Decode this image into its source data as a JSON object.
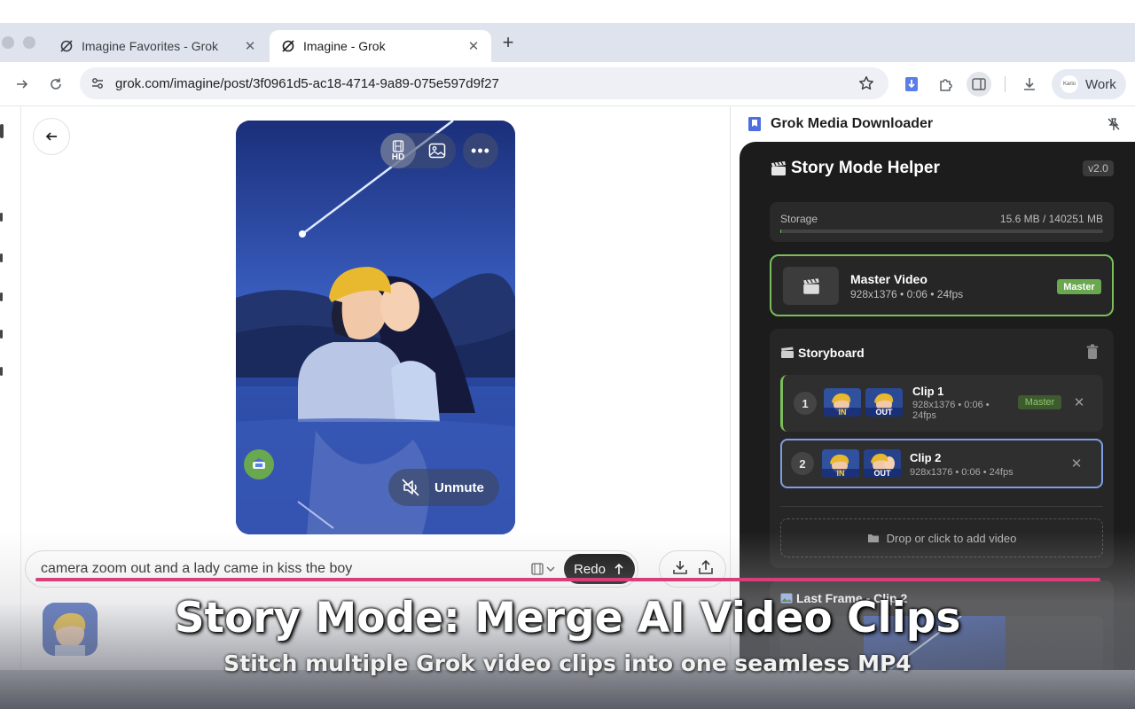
{
  "browser": {
    "tabs": [
      {
        "title": "Imagine Favorites - Grok",
        "active": false
      },
      {
        "title": "Imagine - Grok",
        "active": true
      }
    ],
    "url": "grok.com/imagine/post/3f0961d5-ac18-4714-9a89-075e597d9f27",
    "profile_label": "Work",
    "profile_avatar_text": "Kario"
  },
  "video": {
    "hd_label": "HD",
    "unmute_label": "Unmute"
  },
  "prompt": {
    "value": "camera zoom out and a lady came in kiss the boy",
    "redo_label": "Redo"
  },
  "extension": {
    "title": "Grok Media Downloader",
    "helper_title": "Story Mode Helper",
    "version": "v2.0",
    "storage": {
      "label": "Storage",
      "value": "15.6 MB / 140251 MB",
      "used_fraction": 0.0001
    },
    "master": {
      "name": "Master Video",
      "meta": "928x1376 • 0:06 • 24fps",
      "badge": "Master"
    },
    "storyboard": {
      "title": "Storyboard",
      "clips": [
        {
          "number": "1",
          "name": "Clip 1",
          "meta_line1": "928x1376 • 0:06 •",
          "meta_line2": "24fps",
          "badge": "Master",
          "in_label": "IN",
          "out_label": "OUT"
        },
        {
          "number": "2",
          "name": "Clip 2",
          "meta": "928x1376 • 0:06 • 24fps",
          "in_label": "IN",
          "out_label": "OUT"
        }
      ],
      "dropzone_label": "Drop or click to add video"
    },
    "last_frame_title": "Last Frame - Clip 2"
  },
  "promo": {
    "title": "Story Mode: Merge AI Video Clips",
    "subtitle": "Stitch multiple Grok video clips into one seamless MP4"
  },
  "colors": {
    "accent_line": "#d63f7a",
    "master_green": "#7bbd5a",
    "clip_selected_border": "#7f9ee6",
    "panel_dark": "#1c1c1c"
  }
}
